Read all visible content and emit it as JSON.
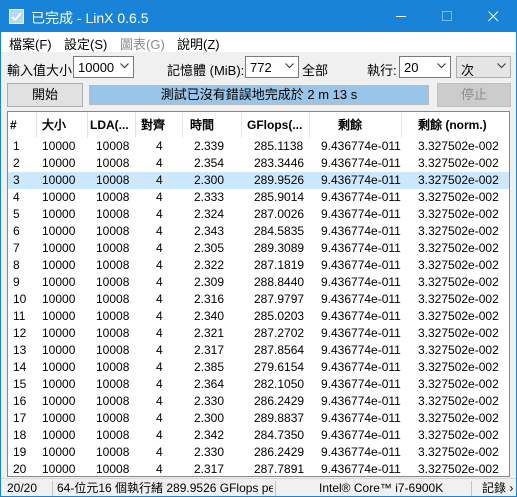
{
  "window": {
    "title": "已完成 - LinX 0.6.5"
  },
  "menu": [
    {
      "label": "檔案(F)",
      "enabled": true
    },
    {
      "label": "設定(S)",
      "enabled": true
    },
    {
      "label": "圖表(G)",
      "enabled": false
    },
    {
      "label": "說明(Z)",
      "enabled": true
    }
  ],
  "settings": {
    "input_size_label": "輸入值大小:",
    "input_size_value": "10000",
    "memory_label": "記憶體 (MiB):",
    "memory_value": "772",
    "all_label": "全部",
    "runs_label": "執行:",
    "runs_value": "20",
    "runs_unit": "次"
  },
  "actions": {
    "start_label": "開始",
    "stop_label": "停止",
    "status_text": "測試已沒有錯誤地完成於 2 m 13 s",
    "progress_percent": 100
  },
  "table": {
    "columns": [
      "#",
      "大小",
      "LDA(...",
      "對齊",
      "時間",
      "GFlops(...",
      "剩餘",
      "剩餘 (norm.)"
    ],
    "selected_row": 3,
    "rows": [
      [
        "1",
        "10000",
        "10008",
        "4",
        "2.339",
        "285.1138",
        "9.436774e-011",
        "3.327502e-002"
      ],
      [
        "2",
        "10000",
        "10008",
        "4",
        "2.354",
        "283.3446",
        "9.436774e-011",
        "3.327502e-002"
      ],
      [
        "3",
        "10000",
        "10008",
        "4",
        "2.300",
        "289.9526",
        "9.436774e-011",
        "3.327502e-002"
      ],
      [
        "4",
        "10000",
        "10008",
        "4",
        "2.333",
        "285.9014",
        "9.436774e-011",
        "3.327502e-002"
      ],
      [
        "5",
        "10000",
        "10008",
        "4",
        "2.324",
        "287.0026",
        "9.436774e-011",
        "3.327502e-002"
      ],
      [
        "6",
        "10000",
        "10008",
        "4",
        "2.343",
        "284.5835",
        "9.436774e-011",
        "3.327502e-002"
      ],
      [
        "7",
        "10000",
        "10008",
        "4",
        "2.305",
        "289.3089",
        "9.436774e-011",
        "3.327502e-002"
      ],
      [
        "8",
        "10000",
        "10008",
        "4",
        "2.322",
        "287.1819",
        "9.436774e-011",
        "3.327502e-002"
      ],
      [
        "9",
        "10000",
        "10008",
        "4",
        "2.309",
        "288.8440",
        "9.436774e-011",
        "3.327502e-002"
      ],
      [
        "10",
        "10000",
        "10008",
        "4",
        "2.316",
        "287.9797",
        "9.436774e-011",
        "3.327502e-002"
      ],
      [
        "11",
        "10000",
        "10008",
        "4",
        "2.340",
        "285.0203",
        "9.436774e-011",
        "3.327502e-002"
      ],
      [
        "12",
        "10000",
        "10008",
        "4",
        "2.321",
        "287.2702",
        "9.436774e-011",
        "3.327502e-002"
      ],
      [
        "13",
        "10000",
        "10008",
        "4",
        "2.317",
        "287.8564",
        "9.436774e-011",
        "3.327502e-002"
      ],
      [
        "14",
        "10000",
        "10008",
        "4",
        "2.385",
        "279.6154",
        "9.436774e-011",
        "3.327502e-002"
      ],
      [
        "15",
        "10000",
        "10008",
        "4",
        "2.364",
        "282.1050",
        "9.436774e-011",
        "3.327502e-002"
      ],
      [
        "16",
        "10000",
        "10008",
        "4",
        "2.330",
        "286.2429",
        "9.436774e-011",
        "3.327502e-002"
      ],
      [
        "17",
        "10000",
        "10008",
        "4",
        "2.300",
        "289.8837",
        "9.436774e-011",
        "3.327502e-002"
      ],
      [
        "18",
        "10000",
        "10008",
        "4",
        "2.342",
        "284.7350",
        "9.436774e-011",
        "3.327502e-002"
      ],
      [
        "19",
        "10000",
        "10008",
        "4",
        "2.330",
        "286.2429",
        "9.436774e-011",
        "3.327502e-002"
      ],
      [
        "20",
        "10000",
        "10008",
        "4",
        "2.317",
        "287.7891",
        "9.436774e-011",
        "3.327502e-002"
      ]
    ]
  },
  "statusbar": {
    "count": "20/20",
    "summary": "64-位元16 個執行緒 289.9526 GFlops pea",
    "cpu": "Intel® Core™ i7-6900K",
    "log": "記錄 ›"
  },
  "colors": {
    "titlebar": "#1883d7",
    "progress_done": "#99c6e8",
    "row_selected": "#cce8ff"
  }
}
